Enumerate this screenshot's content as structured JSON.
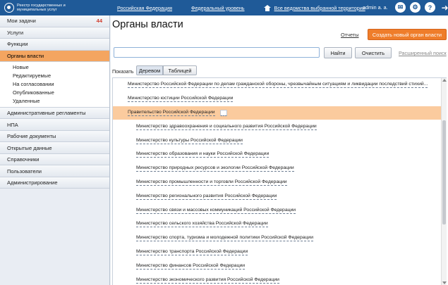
{
  "header": {
    "brand": "Реестр государственных и муниципальных услуг",
    "nav": [
      "Российская Федерация",
      "Федеральный уровень",
      "Все ведомства выбранной территории"
    ],
    "user": "admin a. a.",
    "icons": [
      "chat-icon",
      "settings-icon",
      "help-icon",
      "logout-icon"
    ]
  },
  "sidebar": {
    "items": [
      {
        "label": "Мои задачи",
        "badge": "44"
      },
      {
        "label": "Услуги"
      },
      {
        "label": "Функции"
      },
      {
        "label": "Органы власти"
      },
      {
        "label": "Административные регламенты"
      },
      {
        "label": "НПА"
      },
      {
        "label": "Рабочие документы"
      },
      {
        "label": "Открытые данные"
      },
      {
        "label": "Справочники"
      },
      {
        "label": "Пользователи"
      },
      {
        "label": "Администрирование"
      }
    ],
    "subitems": [
      "Новые",
      "Редактируемые",
      "На согласовании",
      "Опубликованные",
      "Удаленные"
    ]
  },
  "main": {
    "title": "Органы власти",
    "reports": "Отчеты",
    "create_button": "Создать новый орган власти",
    "search_placeholder": "",
    "find_button": "Найти",
    "clear_button": "Очистить",
    "advanced_search": "Расширенный поиск",
    "show_label": "Показать",
    "tabs": [
      "Деревом",
      "Таблицей"
    ],
    "tree": [
      {
        "label": "Министерство Российской Федерации по делам гражданской обороны, чрезвычайным ситуациям и ликвидации последствий стихий...",
        "level": 0
      },
      {
        "label": "Министерство юстиции Российской Федерации",
        "level": 0
      },
      {
        "label": "Правительство Российской Федерации",
        "level": 0,
        "highlight": true
      },
      {
        "label": "Министерство здравоохранения и социального развития Российской Федерации",
        "level": 1
      },
      {
        "label": "Министерство культуры Российской Федерации",
        "level": 1
      },
      {
        "label": "Министерство образования и науки Российской Федерации",
        "level": 1
      },
      {
        "label": "Министерство природных ресурсов и экологии Российской Федерации",
        "level": 1
      },
      {
        "label": "Министерство промышленности и торговли Российской Федерации",
        "level": 1
      },
      {
        "label": "Министерство регионального развития Российской Федерации",
        "level": 1
      },
      {
        "label": "Министерство связи и массовых коммуникаций Российской Федерации",
        "level": 1
      },
      {
        "label": "Министерство сельского хозяйства Российской Федерации",
        "level": 1
      },
      {
        "label": "Министерство спорта, туризма и молодежной политики Российской Федерации",
        "level": 1
      },
      {
        "label": "Министерство транспорта Российской Федерации",
        "level": 1
      },
      {
        "label": "Министерство финансов Российской Федерации",
        "level": 1
      },
      {
        "label": "Министерство экономического развития Российской Федерации",
        "level": 1
      }
    ]
  }
}
